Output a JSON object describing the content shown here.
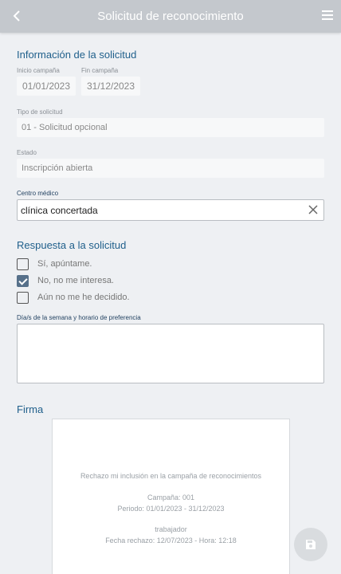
{
  "header": {
    "title": "Solicitud de reconocimiento",
    "back_icon": "chevron-left-icon",
    "menu_icon": "hamburger-menu-icon"
  },
  "info": {
    "section_title": "Información de la solicitud",
    "start_label": "Inicio campaña",
    "start_value": "01/01/2023",
    "end_label": "Fin campaña",
    "end_value": "31/12/2023",
    "type_label": "Tipo de solicitud",
    "type_value": "01 - Solicitud opcional",
    "status_label": "Estado",
    "status_value": "Inscripción abierta",
    "center_label": "Centro médico",
    "center_value": "clínica concertada"
  },
  "response": {
    "section_title": "Respuesta a la solicitud",
    "options": [
      {
        "label": "Sí, apúntame.",
        "checked": false
      },
      {
        "label": "No, no me interesa.",
        "checked": true
      },
      {
        "label": "Aún no me he decidido.",
        "checked": false
      }
    ],
    "preference_label": "Día/s de la semana y horario de preferencia",
    "preference_value": ""
  },
  "signature": {
    "section_title": "Firma",
    "line1": "Rechazo mi inclusión en la campaña de reconocimientos",
    "line2": "Campaña: 001",
    "line3": "Periodo: 01/01/2023 - 31/12/2023",
    "line4": "trabajador",
    "line5": "Fecha rechazo: 12/07/2023 - Hora: 12:18"
  },
  "fab": {
    "icon": "save-icon"
  },
  "colors": {
    "appbar": "#c4c8cd",
    "accent": "#1f5f8b",
    "background": "#eef0f3",
    "checked": "#56708a"
  }
}
